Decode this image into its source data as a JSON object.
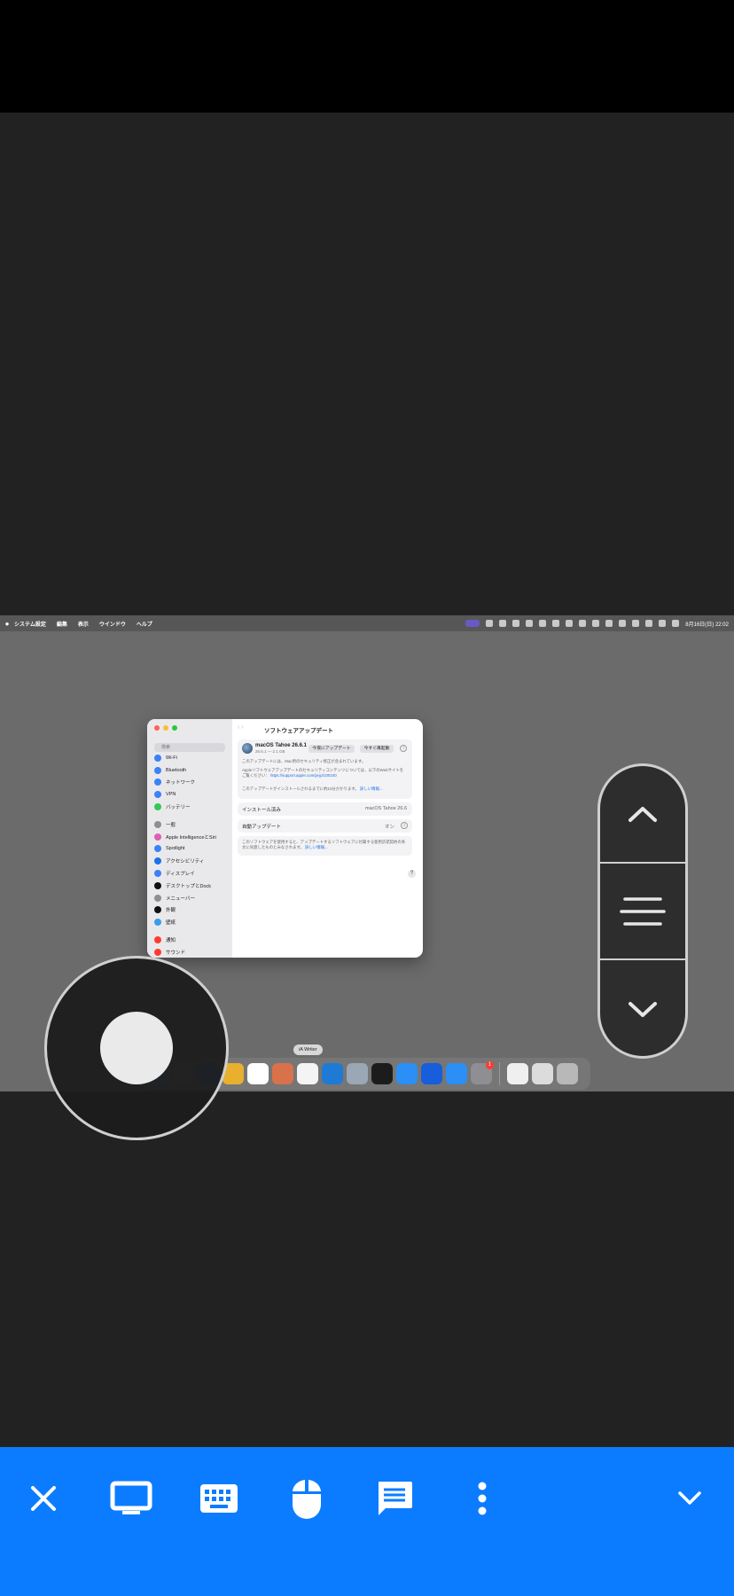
{
  "mac": {
    "menubar": {
      "app": "システム設定",
      "items": [
        "編集",
        "表示",
        "ウインドウ",
        "ヘルプ"
      ],
      "clock": "8月16日(日)  22:02"
    },
    "window": {
      "title": "ソフトウェアアップデート",
      "search_placeholder": "検索",
      "sidebar": [
        {
          "label": "Wi-Fi",
          "color": "#3b82f6"
        },
        {
          "label": "Bluetooth",
          "color": "#3b82f6"
        },
        {
          "label": "ネットワーク",
          "color": "#3b82f6"
        },
        {
          "label": "VPN",
          "color": "#3b82f6"
        },
        {
          "label": "バッテリー",
          "color": "#34c759"
        },
        {
          "label": "一般",
          "color": "#8e8e93",
          "gap": true
        },
        {
          "label": "Apple IntelligenceとSiri",
          "color": "#e05db0"
        },
        {
          "label": "Spotlight",
          "color": "#3b82f6"
        },
        {
          "label": "アクセシビリティ",
          "color": "#1a73e8"
        },
        {
          "label": "ディスプレイ",
          "color": "#3b82f6"
        },
        {
          "label": "デスクトップとDock",
          "color": "#111111"
        },
        {
          "label": "メニューバー",
          "color": "#8e8e93"
        },
        {
          "label": "外観",
          "color": "#111111"
        },
        {
          "label": "壁紙",
          "color": "#3b9de8"
        },
        {
          "label": "通知",
          "color": "#ff3b30",
          "gap": true
        },
        {
          "label": "サウンド",
          "color": "#ff3b30"
        }
      ],
      "update": {
        "name": "macOS Tahoe 26.6.1",
        "size": "26.6.1 — 2.1 GB",
        "update_tonight": "今夜にアップデート",
        "restart_now": "今すぐ再起動",
        "info_glyph": "i",
        "notice1": "このアップデートには、Mac用のセキュリティ修正が含まれています。",
        "notice2": "Appleソフトウェアアップデートのセキュリティコンテンツについては、以下のWebサイトをご覧ください：",
        "notice2_link": "https://support.apple.com/ja-jp/100100",
        "notice3": "このアップデートがインストールされるまでに約10分かかります。",
        "notice3_link": "詳しい情報..."
      },
      "installed_label": "インストール済み",
      "installed_value": "macOS Tahoe 26.6",
      "auto_label": "自動アップデート",
      "auto_value": "オン",
      "license_text": "このソフトウェアを使用すると、アップデートするソフトウェアに付属する使用許諾契約の条文に同意したものとみなされます。",
      "license_link": "詳しい情報...",
      "help_glyph": "?"
    },
    "dock": {
      "tooltip": "iA Writer",
      "apps": [
        {
          "name": "finder",
          "color": "#4a9be8"
        },
        {
          "name": "launchpad",
          "color": "#8a8a8a"
        },
        {
          "name": "safari",
          "color": "#2f78d8"
        },
        {
          "name": "chrome",
          "color": "#e8b02e"
        },
        {
          "name": "chatgpt",
          "color": "#ffffff"
        },
        {
          "name": "claude",
          "color": "#d9714a"
        },
        {
          "name": "ia-writer",
          "color": "#f4f4f4"
        },
        {
          "name": "vscode",
          "color": "#1f7ad6"
        },
        {
          "name": "preview",
          "color": "#9aa7b5"
        },
        {
          "name": "app-grid",
          "color": "#1c1c1c"
        },
        {
          "name": "sync-app",
          "color": "#2b8ff5"
        },
        {
          "name": "bitwarden",
          "color": "#175ddc"
        },
        {
          "name": "app-store",
          "color": "#2b8ff5"
        },
        {
          "name": "system-settings",
          "color": "#8e8e93",
          "badge": "1"
        },
        {
          "name": "document",
          "color": "#efefef",
          "sep_before": true
        },
        {
          "name": "downloads",
          "color": "#dcdcdc"
        },
        {
          "name": "trash",
          "color": "#b8b8b8"
        }
      ]
    }
  },
  "toolbar": {
    "accent": "#0b7cff",
    "items": [
      "close-icon",
      "display-icon",
      "keyboard-icon",
      "mouse-icon",
      "chat-icon",
      "more-icon",
      "chevron-down-icon"
    ]
  }
}
